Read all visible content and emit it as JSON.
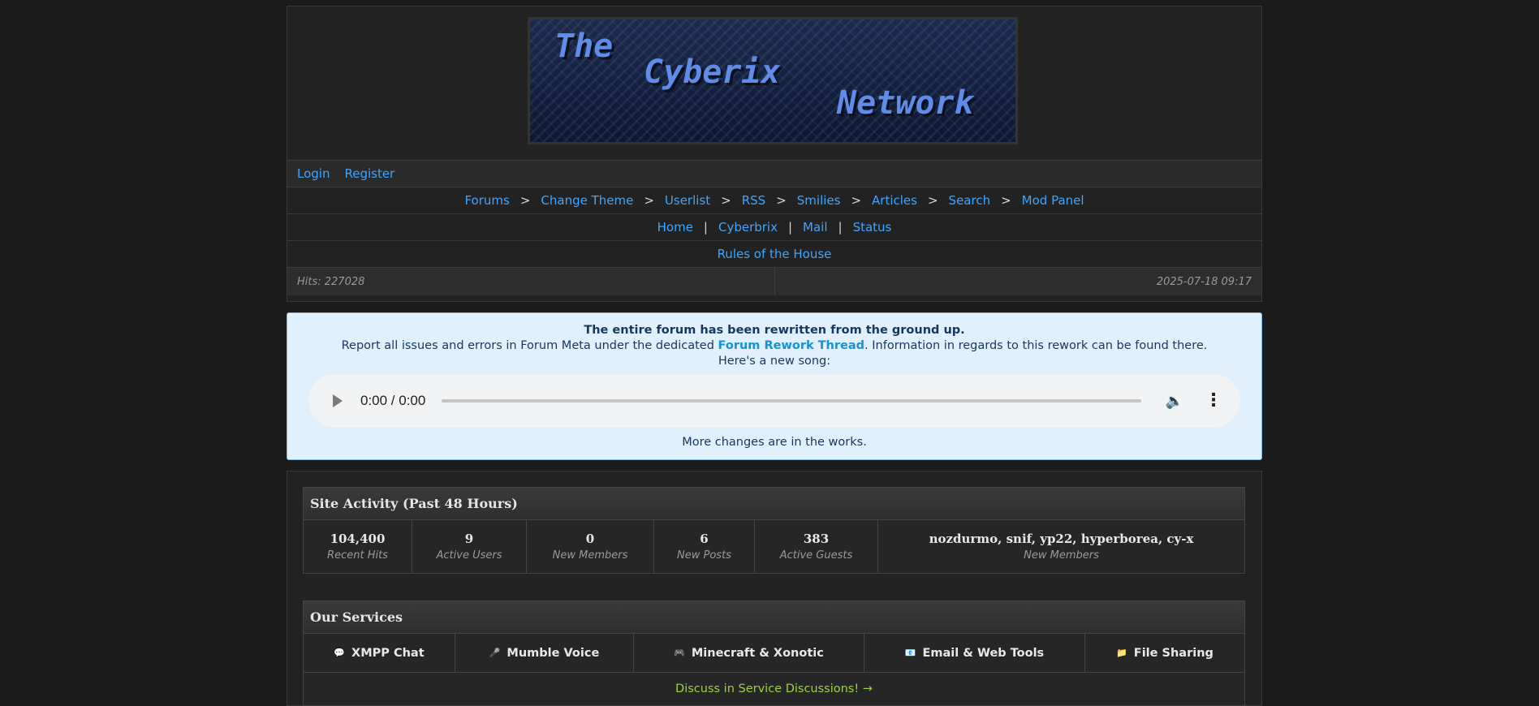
{
  "banner": {
    "word1": "The",
    "word2": "Cyberix",
    "word3": "Network"
  },
  "auth": {
    "login": "Login",
    "register": "Register"
  },
  "nav": {
    "sep": ">",
    "items": [
      "Forums",
      "Change Theme",
      "Userlist",
      "RSS",
      "Smilies",
      "Articles",
      "Search",
      "Mod Panel"
    ]
  },
  "nav2": {
    "sep": "|",
    "items": [
      "Home",
      "Cyberbrix",
      "Mail",
      "Status"
    ]
  },
  "rules": "Rules of the House",
  "info": {
    "hits": "Hits: 227028",
    "datetime": "2025-07-18 09:17"
  },
  "notice": {
    "headline": "The entire forum has been rewritten from the ground up.",
    "line2_pre": "Report all issues and errors in Forum Meta under the dedicated ",
    "line2_link": "Forum Rework Thread",
    "line2_post": ". Information in regards to this rework can be found there.",
    "line3": "Here's a new song:",
    "player_time": "0:00 / 0:00",
    "footer": "More changes are in the works."
  },
  "activity": {
    "title": "Site Activity (Past 48 Hours)",
    "stats": [
      {
        "value": "104,400",
        "label": "Recent Hits"
      },
      {
        "value": "9",
        "label": "Active Users"
      },
      {
        "value": "0",
        "label": "New Members"
      },
      {
        "value": "6",
        "label": "New Posts"
      },
      {
        "value": "383",
        "label": "Active Guests"
      },
      {
        "value": "nozdurmo, snif, yp22, hyperborea, cy-x",
        "label": "New Members"
      }
    ]
  },
  "services": {
    "title": "Our Services",
    "items": [
      {
        "icon": "💬",
        "label": "XMPP Chat"
      },
      {
        "icon": "🎤",
        "label": "Mumble Voice"
      },
      {
        "icon": "🎮",
        "label": "Minecraft & Xonotic"
      },
      {
        "icon": "📧",
        "label": "Email & Web Tools"
      },
      {
        "icon": "📁",
        "label": "File Sharing"
      }
    ],
    "discuss": "Discuss in Service Discussions! →"
  }
}
